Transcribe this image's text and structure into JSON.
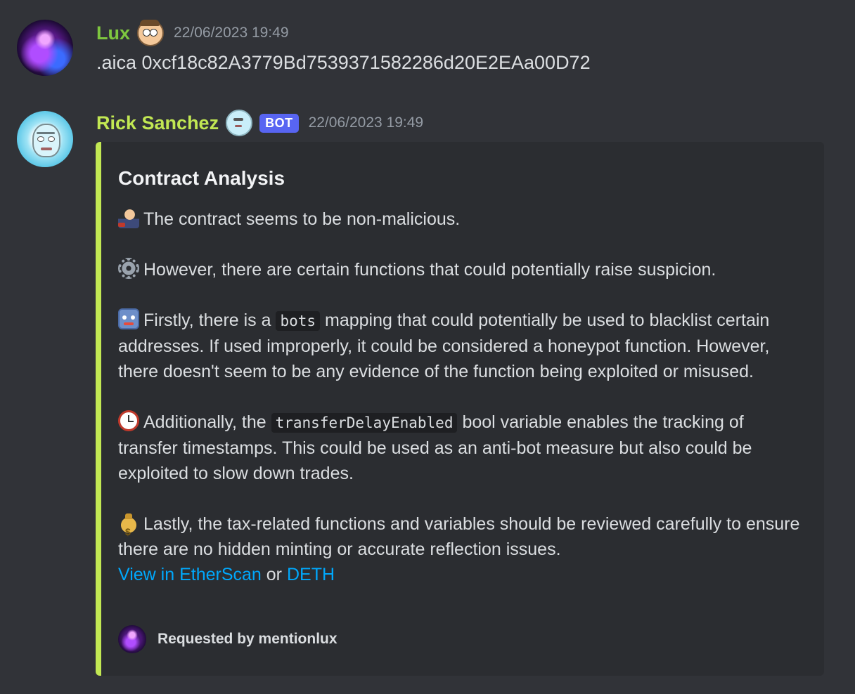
{
  "messages": [
    {
      "author": "Lux",
      "author_color": "#7ec63f",
      "badge_icon": "morty-emoji",
      "timestamp": "22/06/2023 19:49",
      "content": ".aica 0xcf18c82A3779Bd7539371582286d20E2EAa00D72"
    },
    {
      "author": "Rick Sanchez",
      "author_color": "#c2e853",
      "badge_icon": "rick-emoji",
      "bot_tag": "BOT",
      "timestamp": "22/06/2023 19:49",
      "embed": {
        "accent_color": "#c2e853",
        "title": "Contract Analysis",
        "p1": "The contract seems to be non-malicious.",
        "p2": "However, there are certain functions that could potentially raise suspicion.",
        "p3a": "Firstly, there is a",
        "p3code": "bots",
        "p3b": "mapping that could potentially be used to blacklist certain addresses. If used improperly, it could be considered a honeypot function. However, there doesn't seem to be any evidence of the function being exploited or misused.",
        "p4a": "Additionally, the",
        "p4code": "transferDelayEnabled",
        "p4b": "bool variable enables the tracking of transfer timestamps. This could be used as an anti-bot measure but also could be exploited to slow down trades.",
        "p5": "Lastly, the tax-related functions and variables should be reviewed carefully to ensure there are no hidden minting or accurate reflection issues.",
        "link1": "View in EtherScan",
        "link_sep": "or",
        "link2": "DETH",
        "footer": "Requested by mentionlux"
      }
    }
  ]
}
